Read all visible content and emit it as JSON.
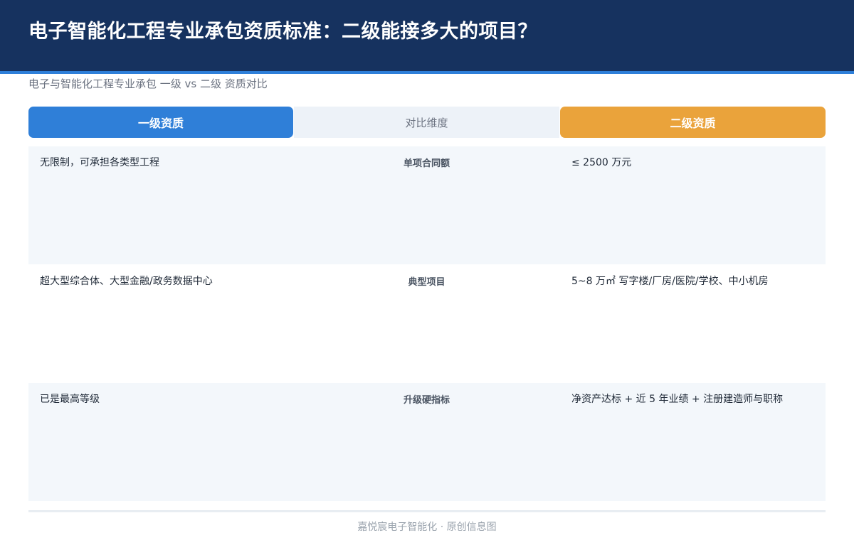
{
  "title": "电子智能化工程专业承包资质标准：二级能接多大的项目？",
  "subtitle": "电子与智能化工程专业承包 一级 vs 二级 资质对比",
  "columns": {
    "left": "一级资质",
    "middle": "对比维度",
    "right": "二级资质"
  },
  "rows": [
    {
      "left": "无限制，可承担各类型工程",
      "dimension": "单项合同额",
      "right": "≤ 2500 万元"
    },
    {
      "left": "超大型综合体、大型金融/政务数据中心",
      "dimension": "典型项目",
      "right": "5~8 万㎡ 写字楼/厂房/医院/学校、中小机房"
    },
    {
      "left": "已是最高等级",
      "dimension": "升级硬指标",
      "right": "净资产达标 + 近 5 年业绩 + 注册建造师与职称"
    }
  ],
  "footer": "嘉悦宸电子智能化 · 原创信息图",
  "colors": {
    "header_bg": "#16325f",
    "accent_blue": "#2f7fd8",
    "accent_orange": "#eaa33b"
  }
}
